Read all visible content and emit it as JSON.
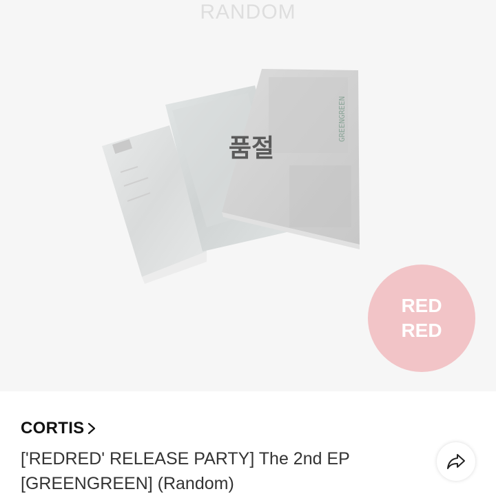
{
  "hero": {
    "random_label": "RANDOM",
    "status_overlay": "품절",
    "badge_lines": [
      "RED",
      "RED"
    ],
    "album_spine_text": "GREENGREEN"
  },
  "product": {
    "artist": "CORTIS",
    "artist_chevron_icon": "chevron-right-icon",
    "title": "['REDRED' RELEASE PARTY] The 2nd EP [GREENGREEN] (Random)",
    "share_icon": "share-arrow-icon"
  },
  "colors": {
    "hero_background": "#f6f6f6",
    "badge": "#f2c4c7",
    "status_overlay_text": "#5a5a5a"
  }
}
